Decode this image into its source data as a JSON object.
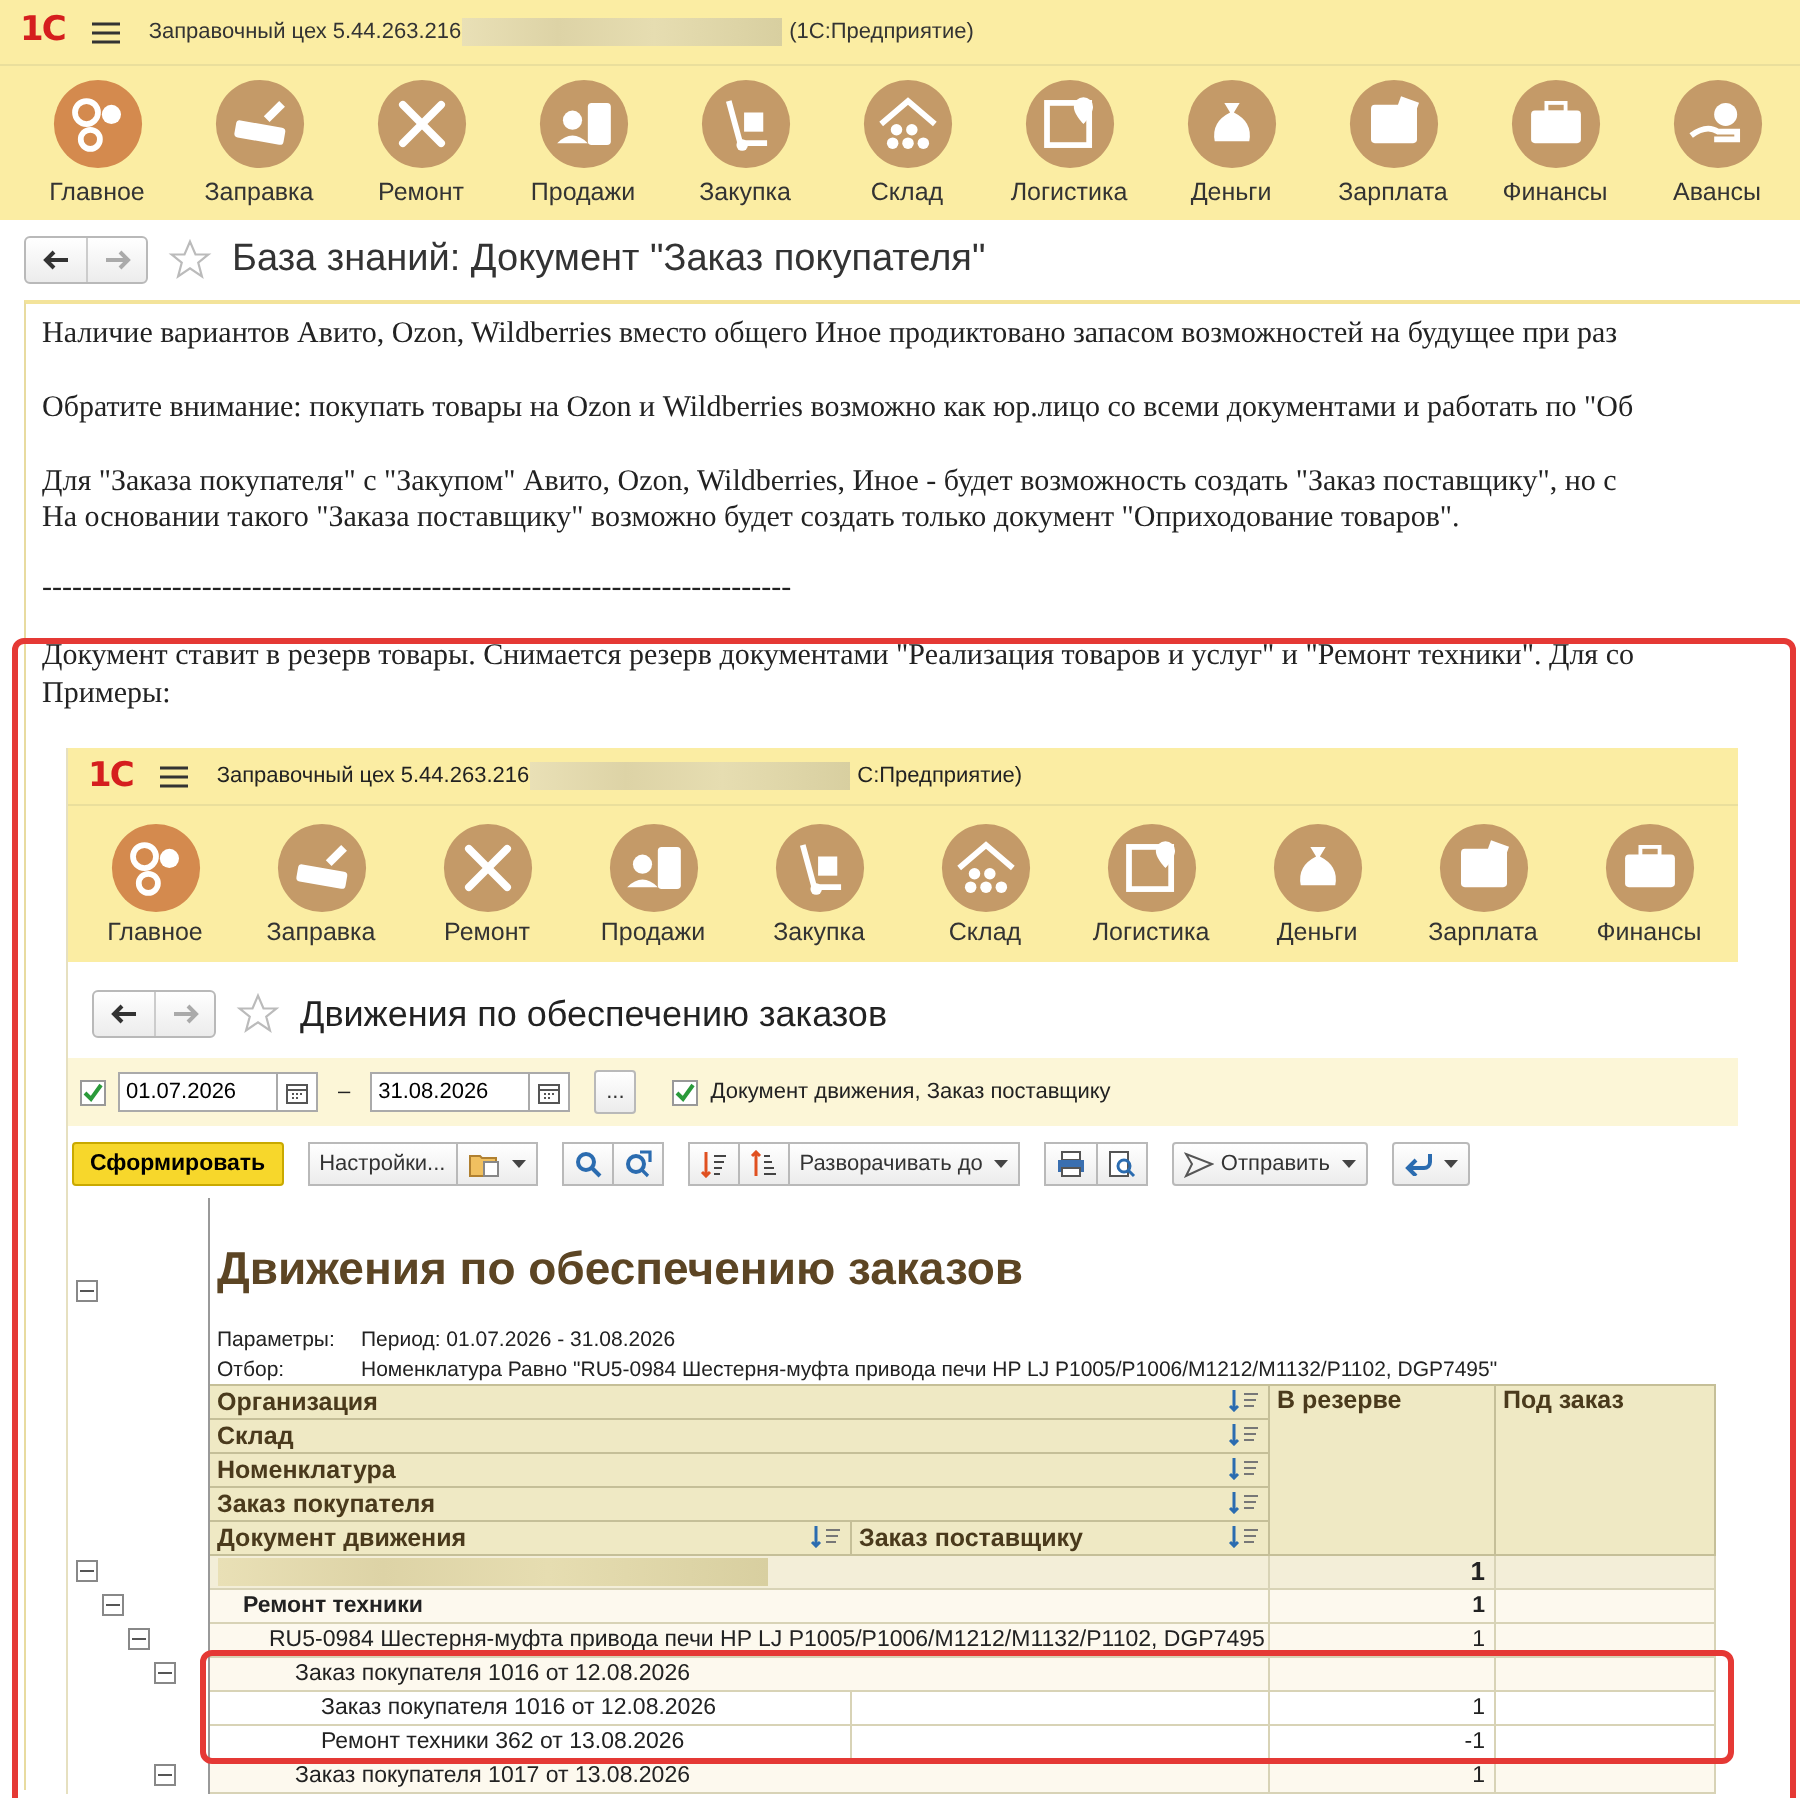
{
  "app_bar": {
    "logo": "1С",
    "title": "Заправочный цех 5.44.263.216",
    "blurred": true,
    "suffix": "(1С:Предприятие)"
  },
  "sections": [
    {
      "label": "Главное",
      "selected": true
    },
    {
      "label": "Заправка",
      "selected": false
    },
    {
      "label": "Ремонт",
      "selected": false
    },
    {
      "label": "Продажи",
      "selected": false
    },
    {
      "label": "Закупка",
      "selected": false
    },
    {
      "label": "Склад",
      "selected": false
    },
    {
      "label": "Логистика",
      "selected": false
    },
    {
      "label": "Деньги",
      "selected": false
    },
    {
      "label": "Зарплата",
      "selected": false
    },
    {
      "label": "Финансы",
      "selected": false
    },
    {
      "label": "Авансы",
      "selected": false
    }
  ],
  "page": {
    "title": "База знаний: Документ \"Заказ покупателя\"",
    "favorite": false
  },
  "article": {
    "intro": [
      [
        "Наличие вариантов Авито, Ozon, Wildberries вместо общего Иное продиктовано запасом возможностей на будущее при раз"
      ],
      [
        "Обратите внимание: покупать товары на Ozon и Wildberries возможно как юр.лицо со всеми документами и работать по \"Об"
      ],
      [
        "Для \"Заказа покупателя\" с \"Закупом\" Авито, Ozon, Wildberries, Иное - будет возможность создать \"Заказ поставщику\", но с",
        "На основании такого \"Заказа поставщику\" возможно будет создать только документ \"Оприходование товаров\"."
      ]
    ],
    "example": {
      "highlighted": true,
      "separator": "---------------------------------------------------------------------------",
      "lines": [
        "Документ ставит в резерв товары. Снимается резерв документами \"Реализация товаров и услуг\" и \"Ремонт техники\". Для со",
        "Примеры:"
      ],
      "screenshot": {
        "app_bar": {
          "logo": "1С",
          "title": "Заправочный цех 5.44.263.216",
          "blurred": true,
          "suffix": "С:Предприятие)"
        },
        "sections": [
          {
            "label": "Главное",
            "selected": true
          },
          {
            "label": "Заправка",
            "selected": false
          },
          {
            "label": "Ремонт",
            "selected": false
          },
          {
            "label": "Продажи",
            "selected": false
          },
          {
            "label": "Закупка",
            "selected": false
          },
          {
            "label": "Склад",
            "selected": false
          },
          {
            "label": "Логистика",
            "selected": false
          },
          {
            "label": "Деньги",
            "selected": false
          },
          {
            "label": "Зарплата",
            "selected": false
          },
          {
            "label": "Финансы",
            "selected": false
          }
        ],
        "title": "Движения по обеспечению заказов",
        "favorite": false,
        "period": {
          "checked": true,
          "from": "01.07.2026",
          "dash": "–",
          "to": "31.08.2026",
          "more": "..."
        },
        "option": {
          "checked": true,
          "label": "Документ движения, Заказ поставщику"
        },
        "toolbar": {
          "generate": "Сформировать",
          "settings": "Настройки...",
          "expand": "Разворачивать до",
          "send": "Отправить"
        },
        "report": {
          "title": "Движения по обеспечению заказов",
          "expanded": true,
          "params_label": "Параметры:",
          "params": "Период: 01.07.2026 - 31.08.2026",
          "filter_label": "Отбор:",
          "filter": "Номенклатура Равно \"RU5-0984 Шестерня-муфта привода печи HP LJ P1005/P1006/M1212/M1132/P1102, DGP7495\"",
          "group_headers": [
            "Организация",
            "Склад",
            "Номенклатура",
            "Заказ покупателя"
          ],
          "document_header": "Документ движения",
          "supplier_header": "Заказ поставщику",
          "columns": [
            "В резерве",
            "Под заказ"
          ],
          "rows": [
            {
              "kind": "organization",
              "blurred": true,
              "reserve": "1",
              "expanded": true,
              "highlighted": false,
              "children": [
                {
                  "kind": "group",
                  "label": "Ремонт техники",
                  "reserve": "1",
                  "expanded": true,
                  "highlighted": false,
                  "children": [
                    {
                      "kind": "item",
                      "label": "RU5-0984 Шестерня-муфта привода печи HP LJ P1005/P1006/M1212/M1132/P1102, DGP7495",
                      "reserve": "1",
                      "expanded": true,
                      "highlighted": false,
                      "children": [
                        {
                          "kind": "order",
                          "label": "Заказ покупателя 1016 от 12.08.2026",
                          "expanded": true,
                          "highlighted": true,
                          "children": [
                            {
                              "kind": "document",
                              "label": "Заказ покупателя 1016 от 12.08.2026",
                              "reserve": "1"
                            },
                            {
                              "kind": "document",
                              "label": "Ремонт техники 362 от 13.08.2026",
                              "reserve": "-1"
                            }
                          ]
                        },
                        {
                          "kind": "order",
                          "label": "Заказ покупателя 1017 от 13.08.2026",
                          "reserve": "1",
                          "expanded": true,
                          "highlighted": false
                        }
                      ]
                    }
                  ]
                }
              ]
            }
          ]
        }
      }
    }
  }
}
